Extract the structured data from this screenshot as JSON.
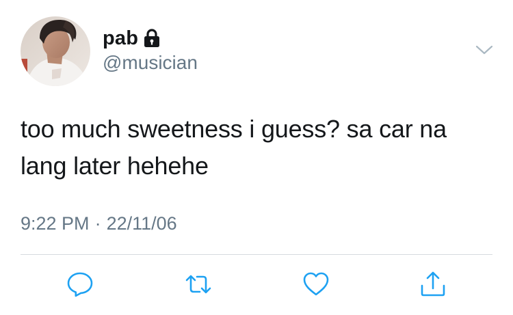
{
  "user": {
    "display_name": "pab",
    "handle": "@musician",
    "protected": true
  },
  "tweet": {
    "text": "too much sweetness i guess? sa car na lang later hehehe",
    "time": "9:22 PM",
    "separator": "·",
    "date": "22/11/06"
  },
  "actions": [
    {
      "icon": "reply-icon"
    },
    {
      "icon": "retweet-icon"
    },
    {
      "icon": "like-heart-icon"
    },
    {
      "icon": "share-icon"
    }
  ],
  "colors": {
    "text": "#14171a",
    "secondary": "#657786",
    "action_icon": "#1da1f2",
    "divider": "#d5dadf"
  }
}
